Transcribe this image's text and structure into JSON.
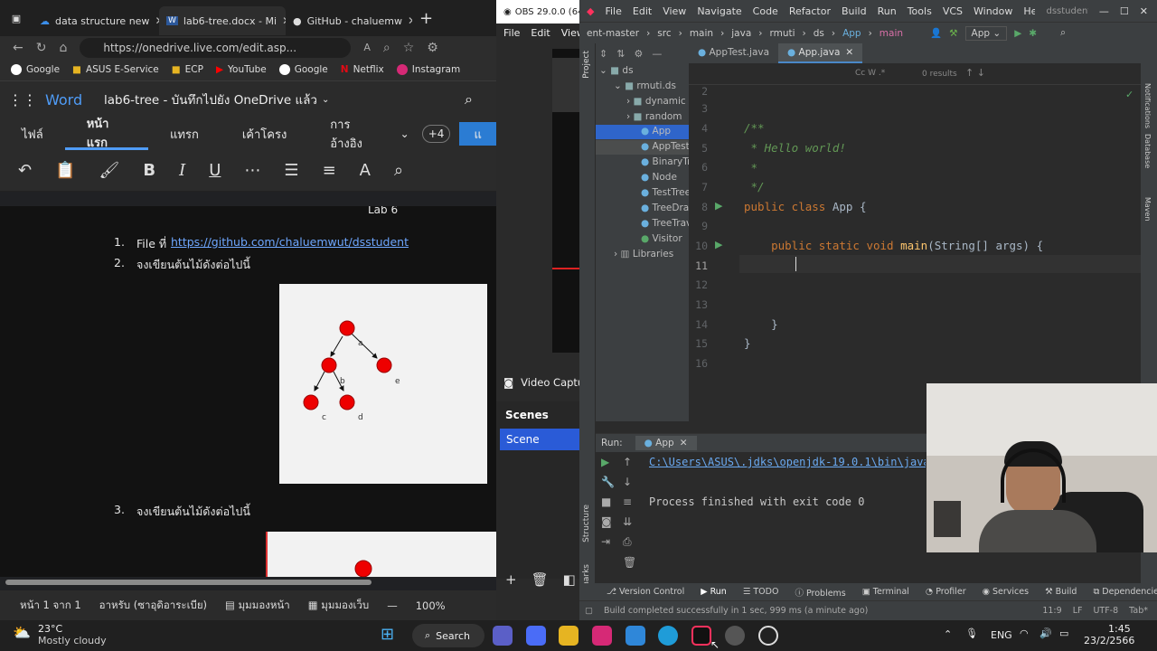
{
  "browser": {
    "tabs": [
      {
        "label": "data structure new",
        "icon": "onedrive-icon"
      },
      {
        "label": "lab6-tree.docx - Mi",
        "icon": "word-icon"
      },
      {
        "label": "GitHub - chaluemw",
        "icon": "github-icon"
      }
    ],
    "url": "https://onedrive.live.com/edit.asp...",
    "bookmarks": [
      "Google",
      "ASUS E-Service",
      "ECP",
      "YouTube",
      "Google",
      "Netflix",
      "Instagram"
    ]
  },
  "word": {
    "app_name": "Word",
    "doc_title": "lab6-tree - บันทึกไปยัง OneDrive แล้ว",
    "ribbon_tabs": [
      "ไฟล์",
      "หน้าแรก",
      "แทรก",
      "เค้าโครง",
      "การอ้างอิง"
    ],
    "more_tabs": "+4",
    "share_label": "แ",
    "header_text": "Lab 6",
    "item1_text": "File ที่",
    "item1_link": "https://github.com/chaluemwut/dsstudent",
    "item2_text": "จงเขียนต้นไม้ดังต่อไปนี้",
    "item3_text": "จงเขียนต้นไม้ดังต่อไปนี้",
    "num1": "1.",
    "num2": "2.",
    "num3": "3.",
    "tree_labels": {
      "a": "a",
      "b": "b",
      "c": "c",
      "d": "d",
      "e": "e"
    },
    "status_page": "หน้า 1 จาก 1",
    "status_lang": "อาหรับ (ซาอุดิอาระเบีย)",
    "status_view1": "มุมมองหน้า",
    "status_view2": "มุมมองเว็บ",
    "zoom": "100%"
  },
  "obs": {
    "title": "OBS 29.0.0 (64",
    "menu_file": "File",
    "menu_edit": "Edit",
    "menu_view": "View",
    "source_label": "Video Captu",
    "scenes_title": "Scenes",
    "scene_item": "Scene"
  },
  "ide": {
    "menu": [
      "File",
      "Edit",
      "View",
      "Navigate",
      "Code",
      "Refactor",
      "Build",
      "Run",
      "Tools",
      "VCS",
      "Window",
      "Help"
    ],
    "project_title": "dsstudent-mast",
    "breadcrumb": [
      "ent-master",
      "src",
      "main",
      "java",
      "rmuti",
      "ds",
      "App",
      "main"
    ],
    "run_config": "App",
    "tabs": [
      "AppTest.java",
      "App.java"
    ],
    "results": "0 results",
    "tree": [
      "ds",
      "rmuti.ds",
      "dynamic",
      "random",
      "App",
      "AppTest",
      "BinaryTr",
      "Node",
      "TestTree",
      "TreeDra",
      "TreeTrav",
      "Visitor",
      "Libraries"
    ],
    "line_numbers": [
      "2",
      "3",
      "4",
      "5",
      "6",
      "7",
      "8",
      "9",
      "10",
      "11",
      "12",
      "13",
      "14",
      "15",
      "16"
    ],
    "code": {
      "l4": "/**",
      "l5": " * Hello world!",
      "l6": " *",
      "l7": " */",
      "l8_kw": "public class ",
      "l8_rest": "App {",
      "l10_kw": "    public static void ",
      "l10_fn": "main",
      "l10_rest": "(String[] args) {",
      "l14": "    }",
      "l15": "}"
    },
    "run_label": "Run:",
    "run_tab": "App",
    "run_cmd": "C:\\Users\\ASUS\\.jdks\\openjdk-19.0.1\\bin\\java",
    "run_output": "Process finished with exit code 0",
    "bottom_tools": [
      "Version Control",
      "Run",
      "TODO",
      "Problems",
      "Terminal",
      "Profiler",
      "Services",
      "Build",
      "Dependencies"
    ],
    "status_msg": "Build completed successfully in 1 sec, 999 ms (a minute ago)",
    "status_pos": "11:9",
    "status_lf": "LF",
    "status_enc": "UTF-8",
    "status_tab": "Tab*",
    "side_labels": [
      "Project",
      "Structure",
      "Bookmarks",
      "Notifications",
      "Database",
      "Maven"
    ]
  },
  "taskbar": {
    "temp": "23°C",
    "weather": "Mostly cloudy",
    "search": "Search",
    "lang": "ENG",
    "time": "1:45",
    "date": "23/2/2566"
  }
}
